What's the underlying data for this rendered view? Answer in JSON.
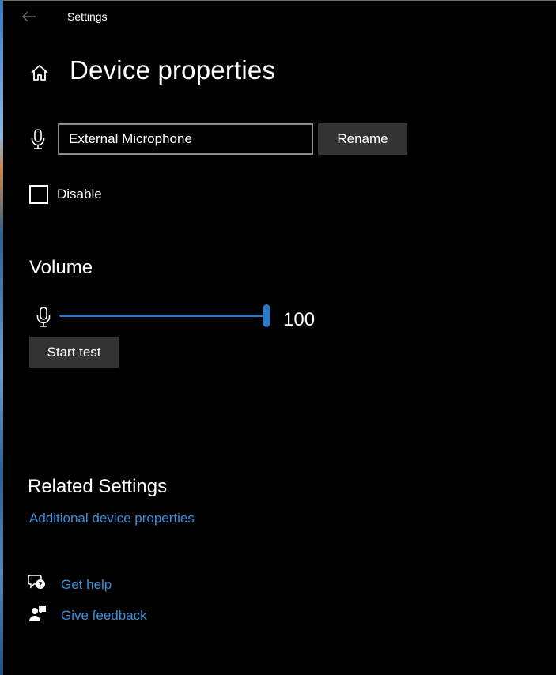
{
  "window": {
    "title": "Settings"
  },
  "page": {
    "title": "Device properties"
  },
  "device": {
    "name_value": "External Microphone",
    "rename_label": "Rename",
    "disable_label": "Disable",
    "disabled": false
  },
  "volume": {
    "heading": "Volume",
    "value": "100",
    "level_percent": 100,
    "start_test_label": "Start test"
  },
  "related": {
    "heading": "Related Settings",
    "additional_link": "Additional device properties"
  },
  "support": {
    "help_label": "Get help",
    "feedback_label": "Give feedback"
  },
  "colors": {
    "accent": "#2a7bc7",
    "link": "#3a8edb",
    "button_bg": "#333333",
    "background": "#000000"
  },
  "icons": {
    "back": "back-arrow-icon",
    "home": "home-icon",
    "mic": "microphone-icon",
    "help": "help-chat-icon",
    "feedback": "feedback-icon"
  }
}
